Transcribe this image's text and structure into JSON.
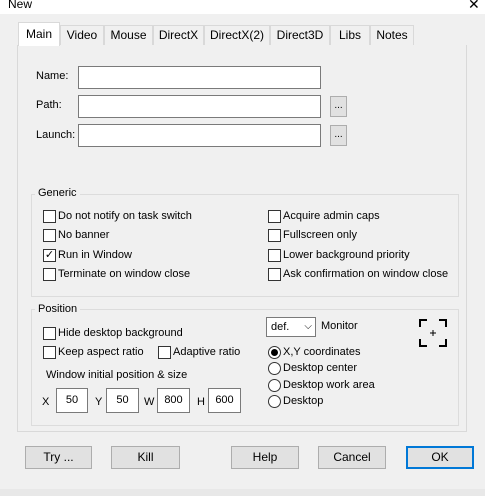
{
  "window": {
    "title": "New",
    "close_glyph": "✕"
  },
  "tabs": [
    {
      "label": "Main",
      "active": true
    },
    {
      "label": "Video"
    },
    {
      "label": "Mouse"
    },
    {
      "label": "DirectX"
    },
    {
      "label": "DirectX(2)"
    },
    {
      "label": "Direct3D"
    },
    {
      "label": "Libs"
    },
    {
      "label": "Notes"
    }
  ],
  "fields": {
    "name": {
      "label": "Name:",
      "value": ""
    },
    "path": {
      "label": "Path:",
      "value": "",
      "browse": "..."
    },
    "launch": {
      "label": "Launch:",
      "value": "",
      "browse": "..."
    }
  },
  "generic": {
    "title": "Generic",
    "options": [
      {
        "label": "Do not notify on task switch",
        "checked": false
      },
      {
        "label": "No banner",
        "checked": false
      },
      {
        "label": "Run in Window",
        "checked": true
      },
      {
        "label": "Terminate on window close",
        "checked": false
      },
      {
        "label": "Acquire admin caps",
        "checked": false
      },
      {
        "label": "Fullscreen only",
        "checked": false
      },
      {
        "label": "Lower background priority",
        "checked": false
      },
      {
        "label": "Ask confirmation on window close",
        "checked": false
      }
    ]
  },
  "position": {
    "title": "Position",
    "hide_desktop_bg": {
      "label": "Hide desktop background",
      "checked": false
    },
    "keep_aspect": {
      "label": "Keep aspect ratio",
      "checked": false
    },
    "adaptive": {
      "label": "Adaptive ratio",
      "checked": false
    },
    "monitor_select": "def.",
    "monitor_label": "Monitor",
    "radios": [
      {
        "label": "X,Y coordinates",
        "selected": true
      },
      {
        "label": "Desktop center",
        "selected": false
      },
      {
        "label": "Desktop work area",
        "selected": false
      },
      {
        "label": "Desktop",
        "selected": false
      }
    ],
    "initial_label": "Window initial position & size",
    "x_label": "X",
    "x": "50",
    "y_label": "Y",
    "y": "50",
    "w_label": "W",
    "w": "800",
    "h_label": "H",
    "h": "600"
  },
  "buttons": {
    "try": "Try ...",
    "kill": "Kill",
    "help": "Help",
    "cancel": "Cancel",
    "ok": "OK"
  },
  "icons": {
    "monitor": "frame-corners-icon"
  },
  "colors": {
    "accent": "#0078d7"
  }
}
